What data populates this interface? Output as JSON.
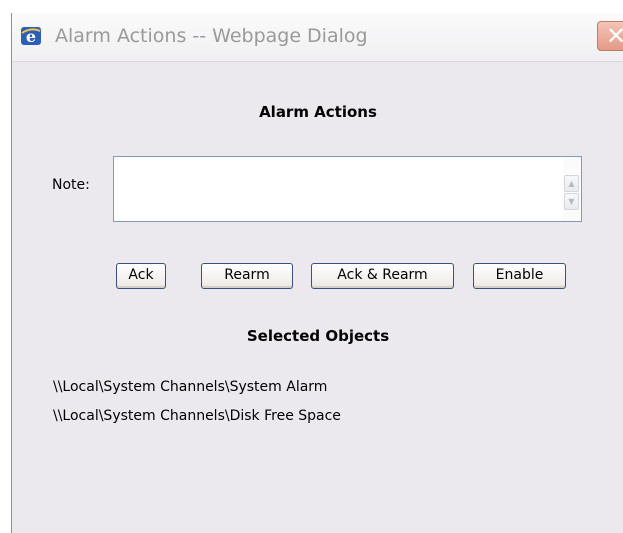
{
  "window": {
    "title": "Alarm Actions -- Webpage Dialog",
    "close_glyph": "✕"
  },
  "dialog": {
    "heading": "Alarm Actions",
    "note_label": "Note:",
    "note_value": "",
    "buttons": {
      "ack": "Ack",
      "rearm": "Rearm",
      "ack_rearm": "Ack & Rearm",
      "enable": "Enable"
    },
    "selected_heading": "Selected Objects",
    "selected_objects": [
      "\\\\Local\\System Channels\\System Alarm",
      "\\\\Local\\System Channels\\Disk Free Space"
    ]
  },
  "icons": {
    "app": "ie-icon",
    "close": "close-icon",
    "scroll_up": "scroll-up-icon",
    "scroll_down": "scroll-down-icon"
  },
  "colors": {
    "dialog_bg": "#ece9ee",
    "title_text": "#9a9a9a",
    "close_button": "#e49a86",
    "button_border": "#3b4f82"
  }
}
